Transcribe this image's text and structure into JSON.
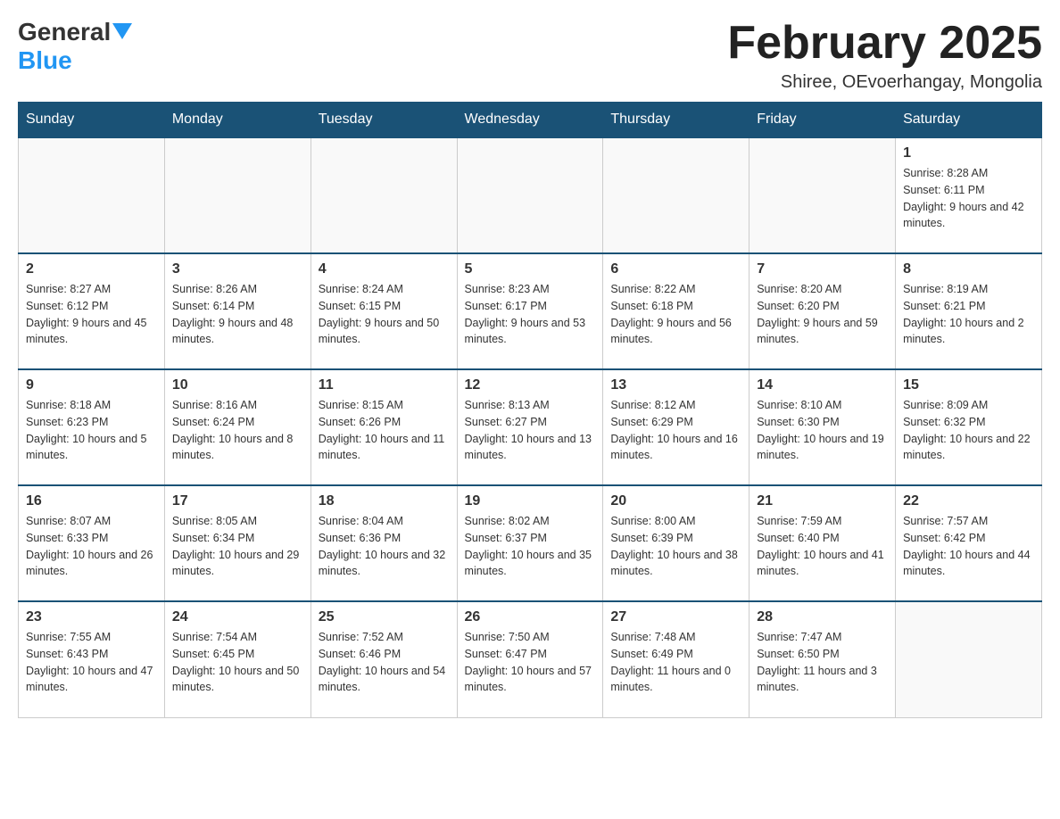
{
  "header": {
    "logo": {
      "general": "General",
      "blue": "Blue",
      "triangle": true
    },
    "title": "February 2025",
    "location": "Shiree, OEvoerhangay, Mongolia"
  },
  "days_of_week": [
    "Sunday",
    "Monday",
    "Tuesday",
    "Wednesday",
    "Thursday",
    "Friday",
    "Saturday"
  ],
  "weeks": [
    [
      {
        "day": "",
        "info": ""
      },
      {
        "day": "",
        "info": ""
      },
      {
        "day": "",
        "info": ""
      },
      {
        "day": "",
        "info": ""
      },
      {
        "day": "",
        "info": ""
      },
      {
        "day": "",
        "info": ""
      },
      {
        "day": "1",
        "info": "Sunrise: 8:28 AM\nSunset: 6:11 PM\nDaylight: 9 hours and 42 minutes."
      }
    ],
    [
      {
        "day": "2",
        "info": "Sunrise: 8:27 AM\nSunset: 6:12 PM\nDaylight: 9 hours and 45 minutes."
      },
      {
        "day": "3",
        "info": "Sunrise: 8:26 AM\nSunset: 6:14 PM\nDaylight: 9 hours and 48 minutes."
      },
      {
        "day": "4",
        "info": "Sunrise: 8:24 AM\nSunset: 6:15 PM\nDaylight: 9 hours and 50 minutes."
      },
      {
        "day": "5",
        "info": "Sunrise: 8:23 AM\nSunset: 6:17 PM\nDaylight: 9 hours and 53 minutes."
      },
      {
        "day": "6",
        "info": "Sunrise: 8:22 AM\nSunset: 6:18 PM\nDaylight: 9 hours and 56 minutes."
      },
      {
        "day": "7",
        "info": "Sunrise: 8:20 AM\nSunset: 6:20 PM\nDaylight: 9 hours and 59 minutes."
      },
      {
        "day": "8",
        "info": "Sunrise: 8:19 AM\nSunset: 6:21 PM\nDaylight: 10 hours and 2 minutes."
      }
    ],
    [
      {
        "day": "9",
        "info": "Sunrise: 8:18 AM\nSunset: 6:23 PM\nDaylight: 10 hours and 5 minutes."
      },
      {
        "day": "10",
        "info": "Sunrise: 8:16 AM\nSunset: 6:24 PM\nDaylight: 10 hours and 8 minutes."
      },
      {
        "day": "11",
        "info": "Sunrise: 8:15 AM\nSunset: 6:26 PM\nDaylight: 10 hours and 11 minutes."
      },
      {
        "day": "12",
        "info": "Sunrise: 8:13 AM\nSunset: 6:27 PM\nDaylight: 10 hours and 13 minutes."
      },
      {
        "day": "13",
        "info": "Sunrise: 8:12 AM\nSunset: 6:29 PM\nDaylight: 10 hours and 16 minutes."
      },
      {
        "day": "14",
        "info": "Sunrise: 8:10 AM\nSunset: 6:30 PM\nDaylight: 10 hours and 19 minutes."
      },
      {
        "day": "15",
        "info": "Sunrise: 8:09 AM\nSunset: 6:32 PM\nDaylight: 10 hours and 22 minutes."
      }
    ],
    [
      {
        "day": "16",
        "info": "Sunrise: 8:07 AM\nSunset: 6:33 PM\nDaylight: 10 hours and 26 minutes."
      },
      {
        "day": "17",
        "info": "Sunrise: 8:05 AM\nSunset: 6:34 PM\nDaylight: 10 hours and 29 minutes."
      },
      {
        "day": "18",
        "info": "Sunrise: 8:04 AM\nSunset: 6:36 PM\nDaylight: 10 hours and 32 minutes."
      },
      {
        "day": "19",
        "info": "Sunrise: 8:02 AM\nSunset: 6:37 PM\nDaylight: 10 hours and 35 minutes."
      },
      {
        "day": "20",
        "info": "Sunrise: 8:00 AM\nSunset: 6:39 PM\nDaylight: 10 hours and 38 minutes."
      },
      {
        "day": "21",
        "info": "Sunrise: 7:59 AM\nSunset: 6:40 PM\nDaylight: 10 hours and 41 minutes."
      },
      {
        "day": "22",
        "info": "Sunrise: 7:57 AM\nSunset: 6:42 PM\nDaylight: 10 hours and 44 minutes."
      }
    ],
    [
      {
        "day": "23",
        "info": "Sunrise: 7:55 AM\nSunset: 6:43 PM\nDaylight: 10 hours and 47 minutes."
      },
      {
        "day": "24",
        "info": "Sunrise: 7:54 AM\nSunset: 6:45 PM\nDaylight: 10 hours and 50 minutes."
      },
      {
        "day": "25",
        "info": "Sunrise: 7:52 AM\nSunset: 6:46 PM\nDaylight: 10 hours and 54 minutes."
      },
      {
        "day": "26",
        "info": "Sunrise: 7:50 AM\nSunset: 6:47 PM\nDaylight: 10 hours and 57 minutes."
      },
      {
        "day": "27",
        "info": "Sunrise: 7:48 AM\nSunset: 6:49 PM\nDaylight: 11 hours and 0 minutes."
      },
      {
        "day": "28",
        "info": "Sunrise: 7:47 AM\nSunset: 6:50 PM\nDaylight: 11 hours and 3 minutes."
      },
      {
        "day": "",
        "info": ""
      }
    ]
  ]
}
